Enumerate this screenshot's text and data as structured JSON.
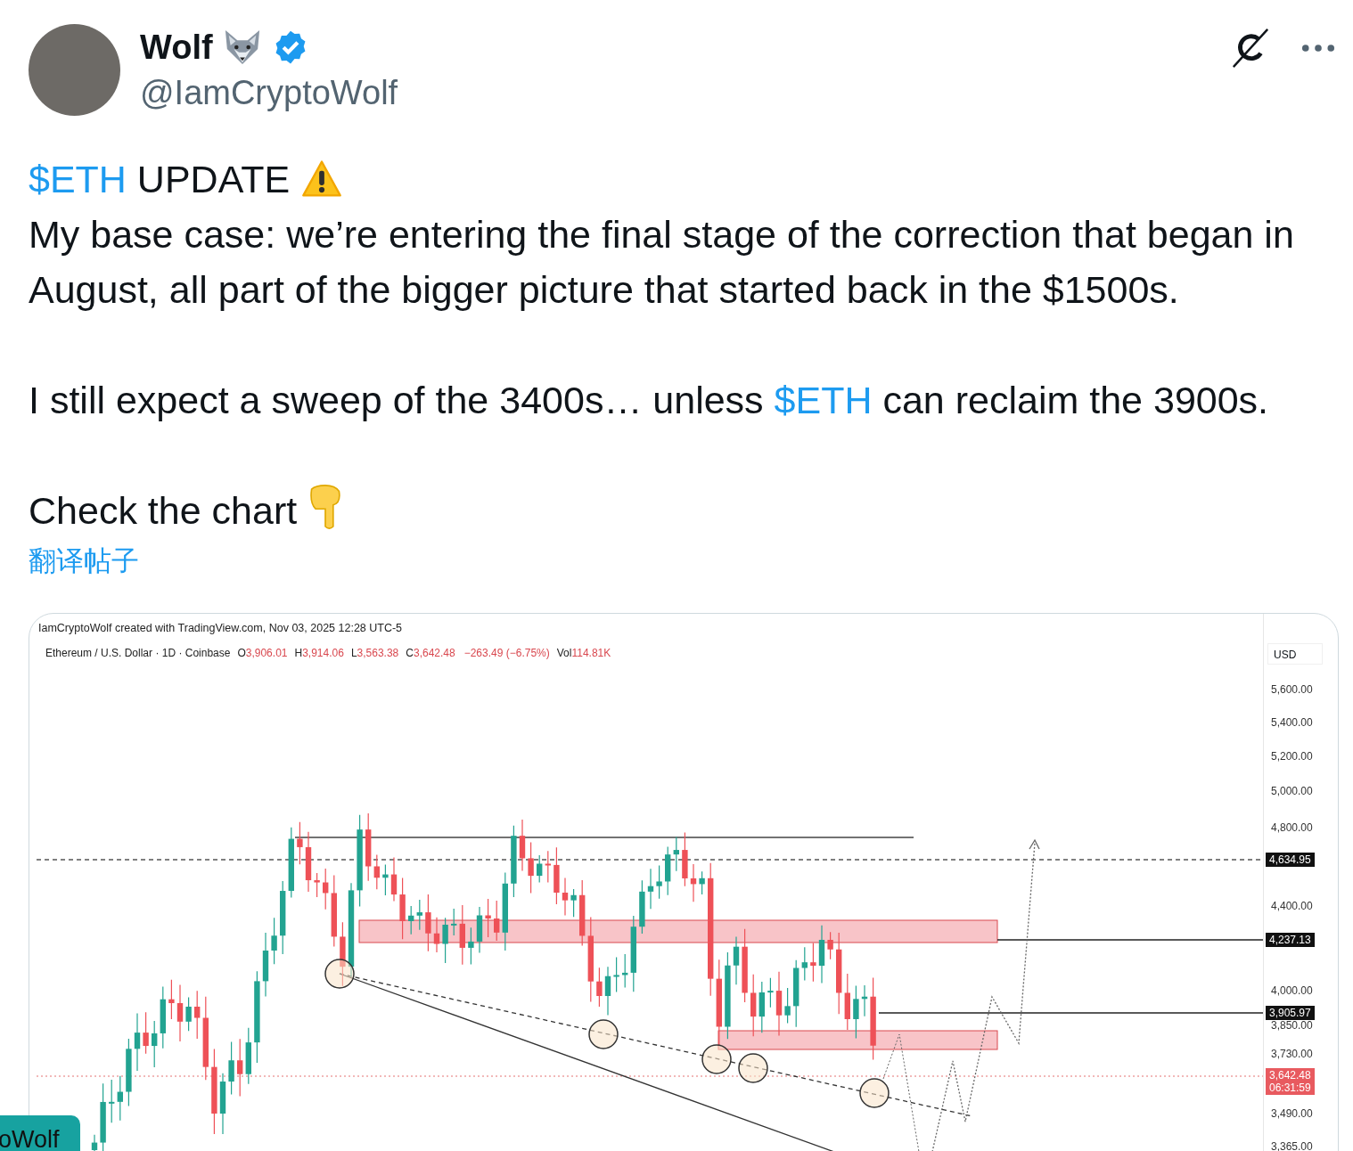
{
  "author": {
    "name": "Wolf",
    "handle": "@IamCryptoWolf",
    "verified": true
  },
  "post": {
    "paragraphs": [
      [
        {
          "text": "$ETH",
          "link": true
        },
        {
          "text": " UPDATE",
          "link": false
        }
      ],
      [
        {
          "text": "My base case: we’re entering the final stage of the correction that began in August, all part of the bigger picture that started back in the $1500s.",
          "link": false
        }
      ],
      [
        {
          "text": "I still expect a sweep of the 3400s… unless ",
          "link": false
        },
        {
          "text": "$ETH",
          "link": true
        },
        {
          "text": " can reclaim the 3900s.",
          "link": false
        }
      ],
      [
        {
          "text": "Check the chart",
          "link": false
        }
      ]
    ],
    "translate": "翻译帖子"
  },
  "chart_image": {
    "credit": "IamCryptoWolf created with TradingView.com, Nov 03, 2025 12:28 UTC-5",
    "symbol": "Ethereum / U.S. Dollar · 1D · Coinbase",
    "ohlc": [
      {
        "label": "O",
        "value": "3,906.01"
      },
      {
        "label": "H",
        "value": "3,914.06"
      },
      {
        "label": "L",
        "value": "3,563.38"
      },
      {
        "label": "C",
        "value": "3,642.48"
      }
    ],
    "change": "−263.49 (−6.75%)",
    "volume": {
      "label": "Vol",
      "value": "114.81K"
    },
    "currency": "USD",
    "price_labels": [
      {
        "kind": "tick",
        "label": "5,600.00"
      },
      {
        "kind": "tick",
        "label": "5,400.00"
      },
      {
        "kind": "tick",
        "label": "5,200.00"
      },
      {
        "kind": "tick",
        "label": "5,000.00"
      },
      {
        "kind": "tick",
        "label": "4,800.00"
      },
      {
        "kind": "tag",
        "label": "4,634.95"
      },
      {
        "kind": "tick",
        "label": "4,400.00"
      },
      {
        "kind": "tag",
        "label": "4,237.13"
      },
      {
        "kind": "tick",
        "label": "4,000.00"
      },
      {
        "kind": "tag",
        "label": "3,905.97"
      },
      {
        "kind": "tick",
        "label": "3,850.00"
      },
      {
        "kind": "tick",
        "label": "3,730.00"
      },
      {
        "kind": "current",
        "label": "3,642.48",
        "sub": "06:31:59"
      },
      {
        "kind": "tick",
        "label": "3,490.00"
      },
      {
        "kind": "tick",
        "label": "3,365.00"
      }
    ],
    "corner_badge": "oWolf"
  }
}
